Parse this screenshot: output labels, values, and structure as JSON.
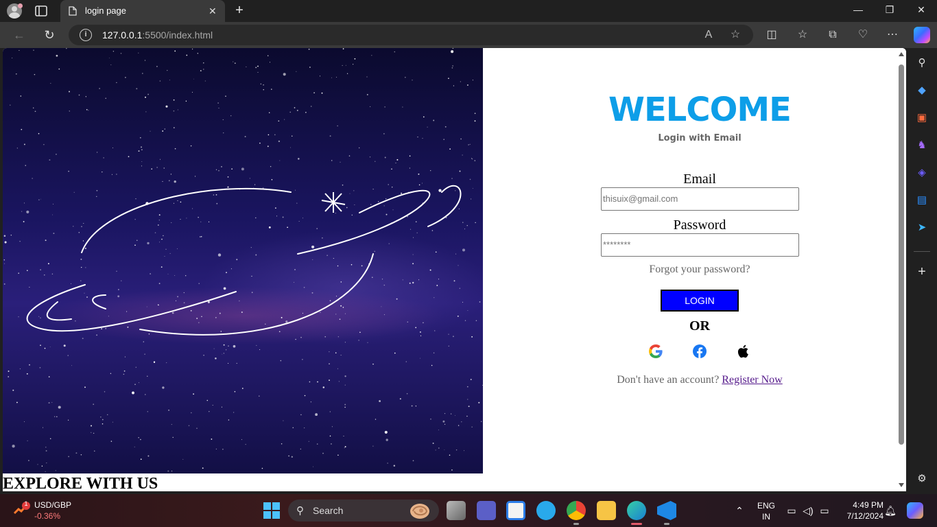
{
  "browser": {
    "tab_title": "login page",
    "url_host": "127.0.0.1",
    "url_path": ":5500/index.html"
  },
  "page": {
    "left_caption": "EXPLORE WITH US",
    "welcome": "WELCOME",
    "subtitle": "Login with Email",
    "email_label": "Email",
    "email_placeholder": "thisuix@gmail.com",
    "password_label": "Password",
    "password_placeholder": "********",
    "forgot": "Forgot your password?",
    "login_button": "LOGIN",
    "or": "OR",
    "register_prompt": "Don't have an account? ",
    "register_link": "Register Now",
    "social_icons": [
      "google-icon",
      "facebook-icon",
      "apple-icon"
    ]
  },
  "taskbar": {
    "ticker_name": "USD/GBP",
    "ticker_change": "-0.36%",
    "ticker_badge": "1",
    "search_placeholder": "Search",
    "lang_line1": "ENG",
    "lang_line2": "IN",
    "time": "4:49 PM",
    "date": "7/12/2024"
  },
  "colors": {
    "welcome": "#0d9ee8",
    "login_button": "#0000ff",
    "link": "#551a8b"
  }
}
